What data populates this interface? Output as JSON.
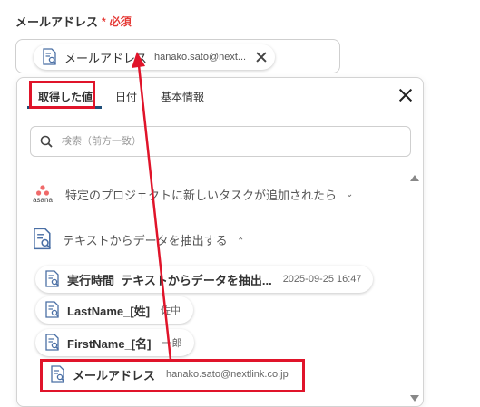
{
  "field": {
    "label": "メールアドレス",
    "required_mark": "*",
    "required_text": "必須",
    "selected_chip": {
      "name": "メールアドレス",
      "value": "hanako.sato@next..."
    }
  },
  "panel": {
    "tabs": [
      {
        "label": "取得した値",
        "active": true
      },
      {
        "label": "日付",
        "active": false
      },
      {
        "label": "基本情報",
        "active": false
      }
    ],
    "search_placeholder": "検索（前方一致）",
    "groups": [
      {
        "title": "特定のプロジェクトに新しいタスクが追加されたら",
        "icon": "asana-logo",
        "logo_text": "asana",
        "expanded": false
      },
      {
        "title": "テキストからデータを抽出する",
        "icon": "document-search-icon",
        "expanded": true
      }
    ],
    "items": [
      {
        "name": "実行時間_テキストからデータを抽出...",
        "value": "2025-09-25 16:47"
      },
      {
        "name": "LastName_[姓]",
        "value": "佐中"
      },
      {
        "name": "FirstName_[名]",
        "value": "一郎"
      },
      {
        "name": "メールアドレス",
        "value": "hanako.sato@nextlink.co.jp"
      }
    ]
  },
  "colors": {
    "accent_underline": "#1f4e79",
    "annotation_red": "#e0142a",
    "required_red": "#e53935"
  }
}
